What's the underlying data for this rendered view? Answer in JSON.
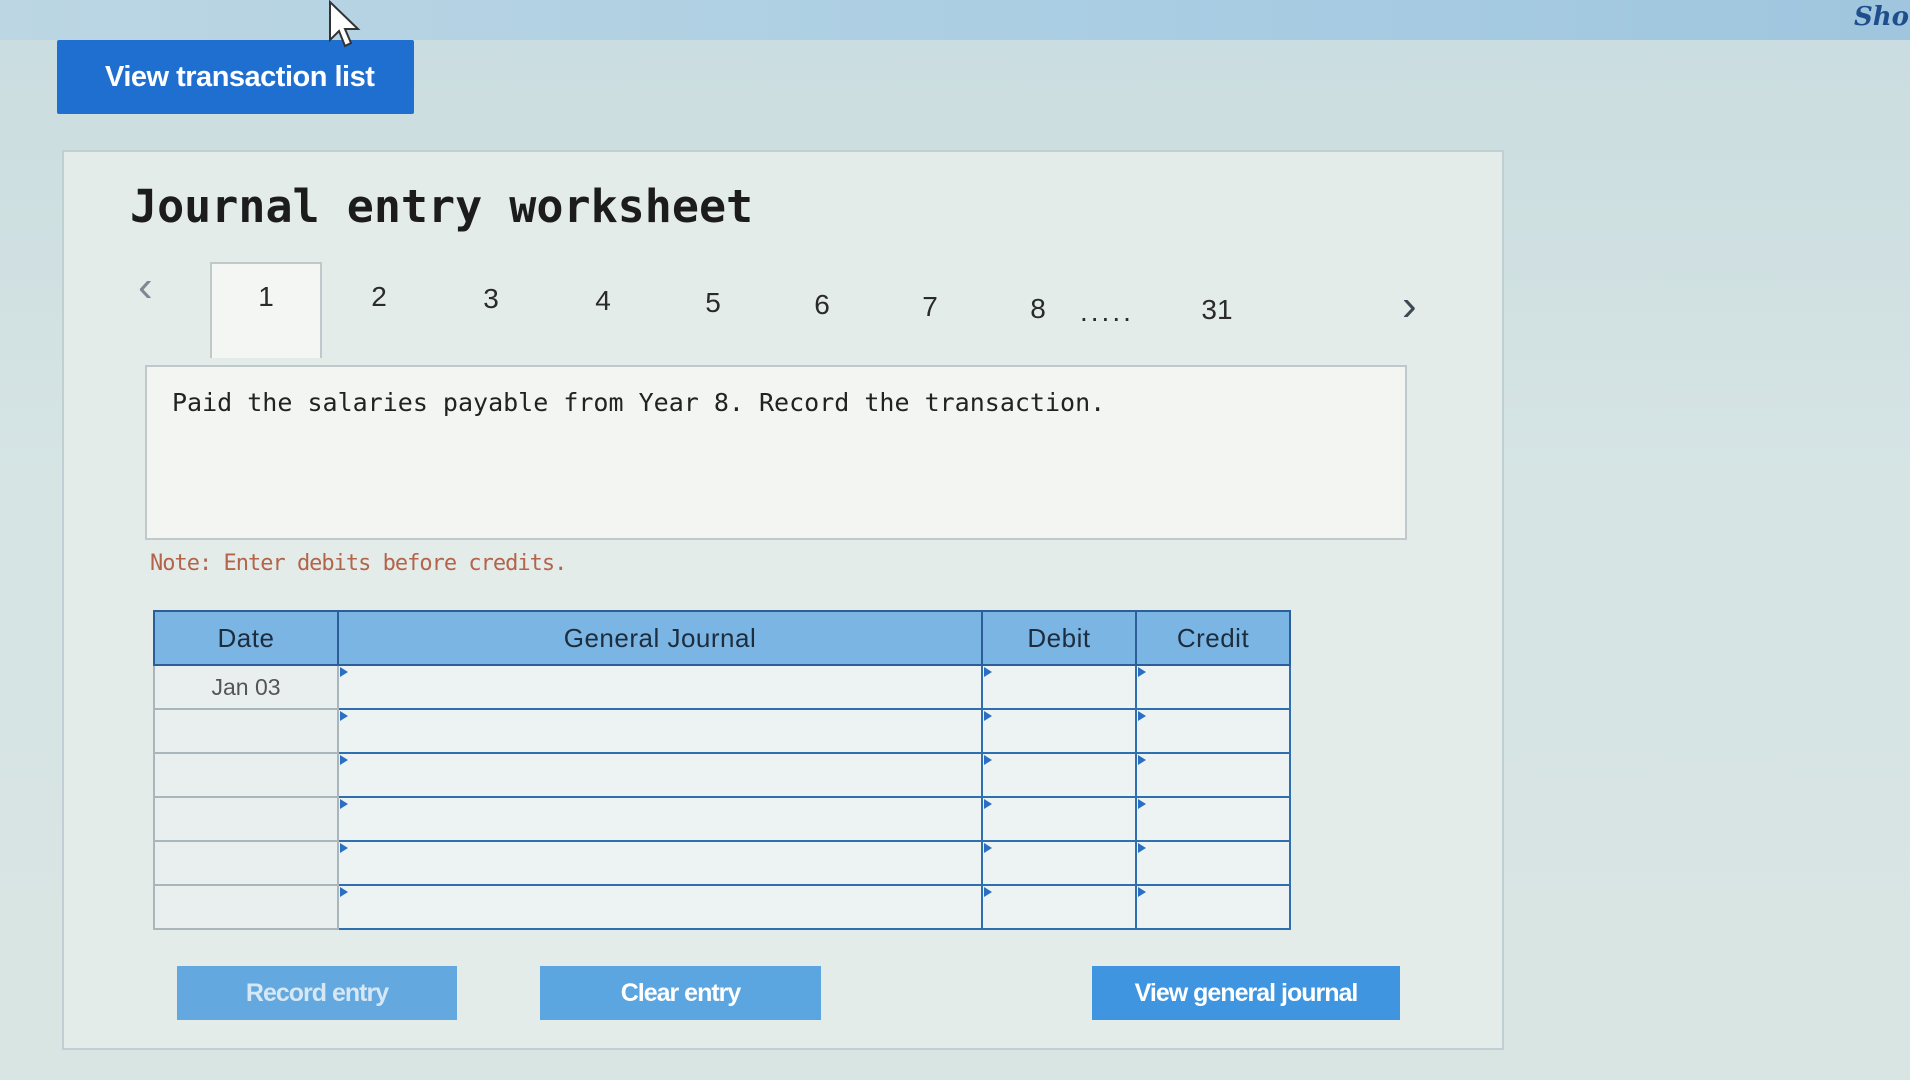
{
  "header": {
    "show_link": "Show"
  },
  "toolbar": {
    "view_transaction_list": "View transaction list"
  },
  "worksheet": {
    "title": "Journal entry worksheet",
    "pager": {
      "prev_icon": "chevron-left-icon",
      "next_icon": "chevron-right-icon",
      "tabs": [
        "1",
        "2",
        "3",
        "4",
        "5",
        "6",
        "7",
        "8",
        "31"
      ],
      "active_tab": "1",
      "ellipsis": "....."
    },
    "description": "Paid the salaries payable from Year 8. Record the transaction.",
    "note": "Note: Enter debits before credits.",
    "table": {
      "headers": [
        "Date",
        "General Journal",
        "Debit",
        "Credit"
      ],
      "rows": [
        {
          "date": "Jan 03",
          "account": "",
          "debit": "",
          "credit": ""
        },
        {
          "date": "",
          "account": "",
          "debit": "",
          "credit": ""
        },
        {
          "date": "",
          "account": "",
          "debit": "",
          "credit": ""
        },
        {
          "date": "",
          "account": "",
          "debit": "",
          "credit": ""
        },
        {
          "date": "",
          "account": "",
          "debit": "",
          "credit": ""
        },
        {
          "date": "",
          "account": "",
          "debit": "",
          "credit": ""
        }
      ]
    },
    "buttons": {
      "record_entry": "Record entry",
      "clear_entry": "Clear entry",
      "view_general_journal": "View general journal"
    }
  },
  "colors": {
    "primary_button": "#1f6fd1",
    "table_header": "#7bb5e4",
    "note_text": "#b3644a",
    "action_button": "#5ba6e0"
  }
}
